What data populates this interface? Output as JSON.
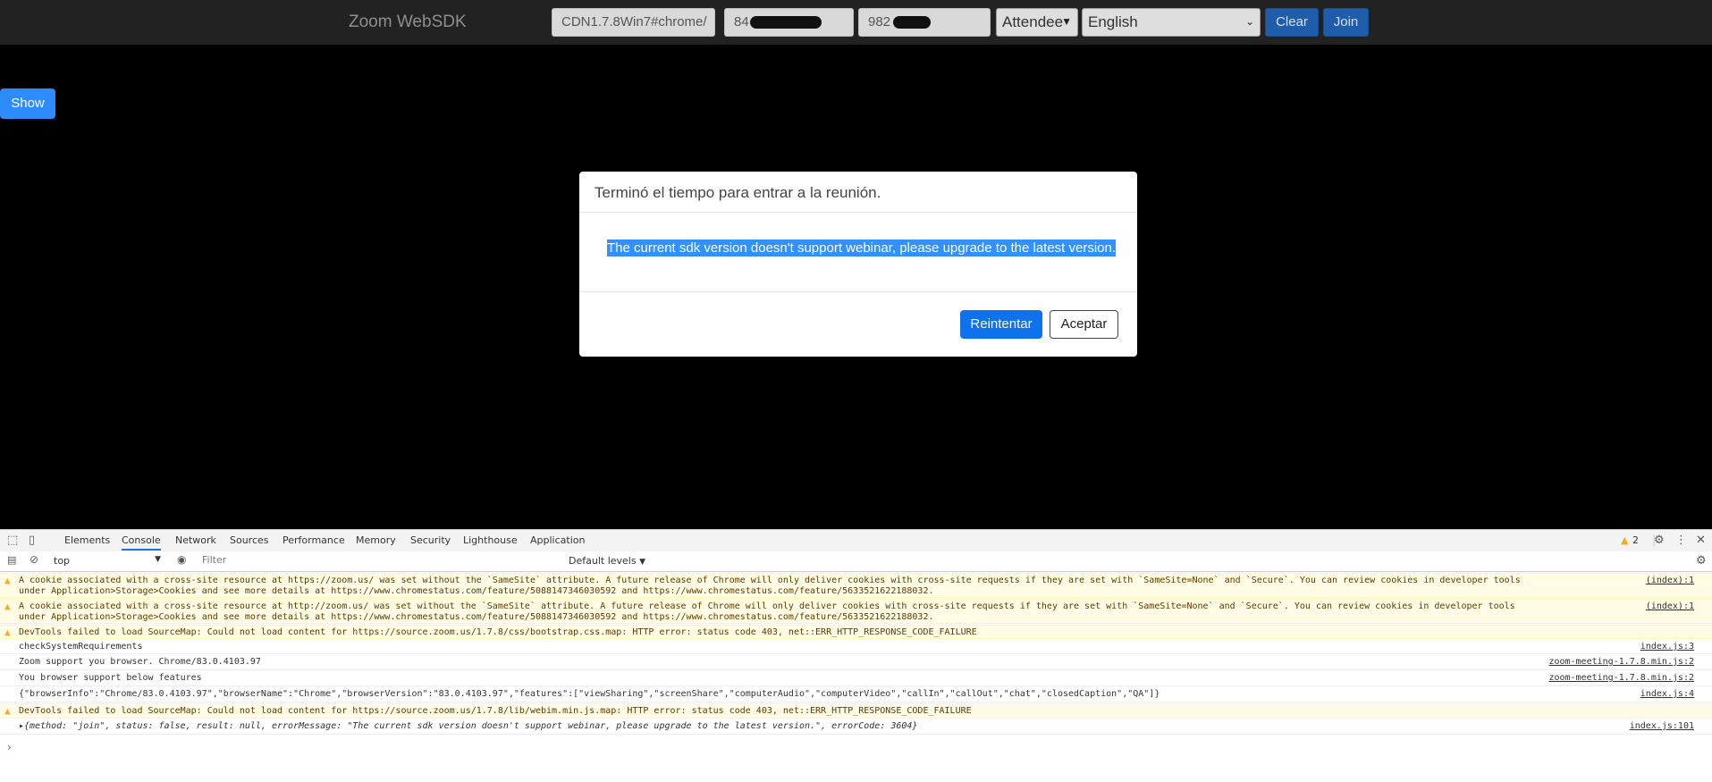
{
  "topbar": {
    "brand": "Zoom WebSDK",
    "display_name": "CDN1.7.8Win7#chrome/",
    "meeting_number": "84",
    "password": "982",
    "role": "Attendee",
    "language": "English",
    "clear_label": "Clear",
    "join_label": "Join"
  },
  "show_label": "Show",
  "dialog": {
    "title": "Terminó el tiempo para entrar a la reunión.",
    "message": "The current sdk version doesn't support webinar, please upgrade to the latest version.",
    "retry_label": "Reintentar",
    "accept_label": "Aceptar"
  },
  "devtools": {
    "tabs": [
      "Elements",
      "Console",
      "Network",
      "Sources",
      "Performance",
      "Memory",
      "Security",
      "Lighthouse",
      "Application"
    ],
    "active_tab": "Console",
    "warning_count": "2",
    "context": "top",
    "filter_placeholder": "Filter",
    "levels": "Default levels",
    "logs": [
      {
        "level": "warn",
        "text": "A cookie associated with a cross-site resource at https://zoom.us/ was set without the `SameSite` attribute. A future release of Chrome will only deliver cookies with cross-site requests if they are set with `SameSite=None` and `Secure`. You can review cookies in developer tools under Application>Storage>Cookies and see more details at https://www.chromestatus.com/feature/5088147346030592 and https://www.chromestatus.com/feature/5633521622188032.",
        "source": "(index):1"
      },
      {
        "level": "warn",
        "text": "A cookie associated with a cross-site resource at http://zoom.us/ was set without the `SameSite` attribute. A future release of Chrome will only deliver cookies with cross-site requests if they are set with `SameSite=None` and `Secure`. You can review cookies in developer tools under Application>Storage>Cookies and see more details at https://www.chromestatus.com/feature/5088147346030592 and https://www.chromestatus.com/feature/5633521622188032.",
        "source": "(index):1"
      },
      {
        "level": "warn",
        "text": "DevTools failed to load SourceMap: Could not load content for https://source.zoom.us/1.7.8/css/bootstrap.css.map: HTTP error: status code 403, net::ERR_HTTP_RESPONSE_CODE_FAILURE",
        "source": ""
      },
      {
        "level": "info",
        "text": "checkSystemRequirements",
        "source": "index.js:3"
      },
      {
        "level": "info",
        "text": "Zoom support you browser. Chrome/83.0.4103.97",
        "source": "zoom-meeting-1.7.8.min.js:2"
      },
      {
        "level": "info",
        "text": "You browser support below features",
        "source": "zoom-meeting-1.7.8.min.js:2"
      },
      {
        "level": "info",
        "text": "{\"browserInfo\":\"Chrome/83.0.4103.97\",\"browserName\":\"Chrome\",\"browserVersion\":\"83.0.4103.97\",\"features\":[\"viewSharing\",\"screenShare\",\"computerAudio\",\"computerVideo\",\"callIn\",\"callOut\",\"chat\",\"closedCaption\",\"QA\"]}",
        "source": "index.js:4"
      },
      {
        "level": "warn",
        "text": "DevTools failed to load SourceMap: Could not load content for https://source.zoom.us/1.7.8/lib/webim.min.js.map: HTTP error: status code 403, net::ERR_HTTP_RESPONSE_CODE_FAILURE",
        "source": ""
      },
      {
        "level": "info",
        "text": "▸{method: \"join\", status: false, result: null, errorMessage: \"The current sdk version doesn't support webinar, please upgrade to the latest version.\", errorCode: 3604}",
        "source": "index.js:101"
      }
    ]
  },
  "colors": {
    "accent": "#2d8cff",
    "dialog_primary": "#0e72ed",
    "selection": "#3390ff",
    "warn_bg": "#fffbe5"
  }
}
